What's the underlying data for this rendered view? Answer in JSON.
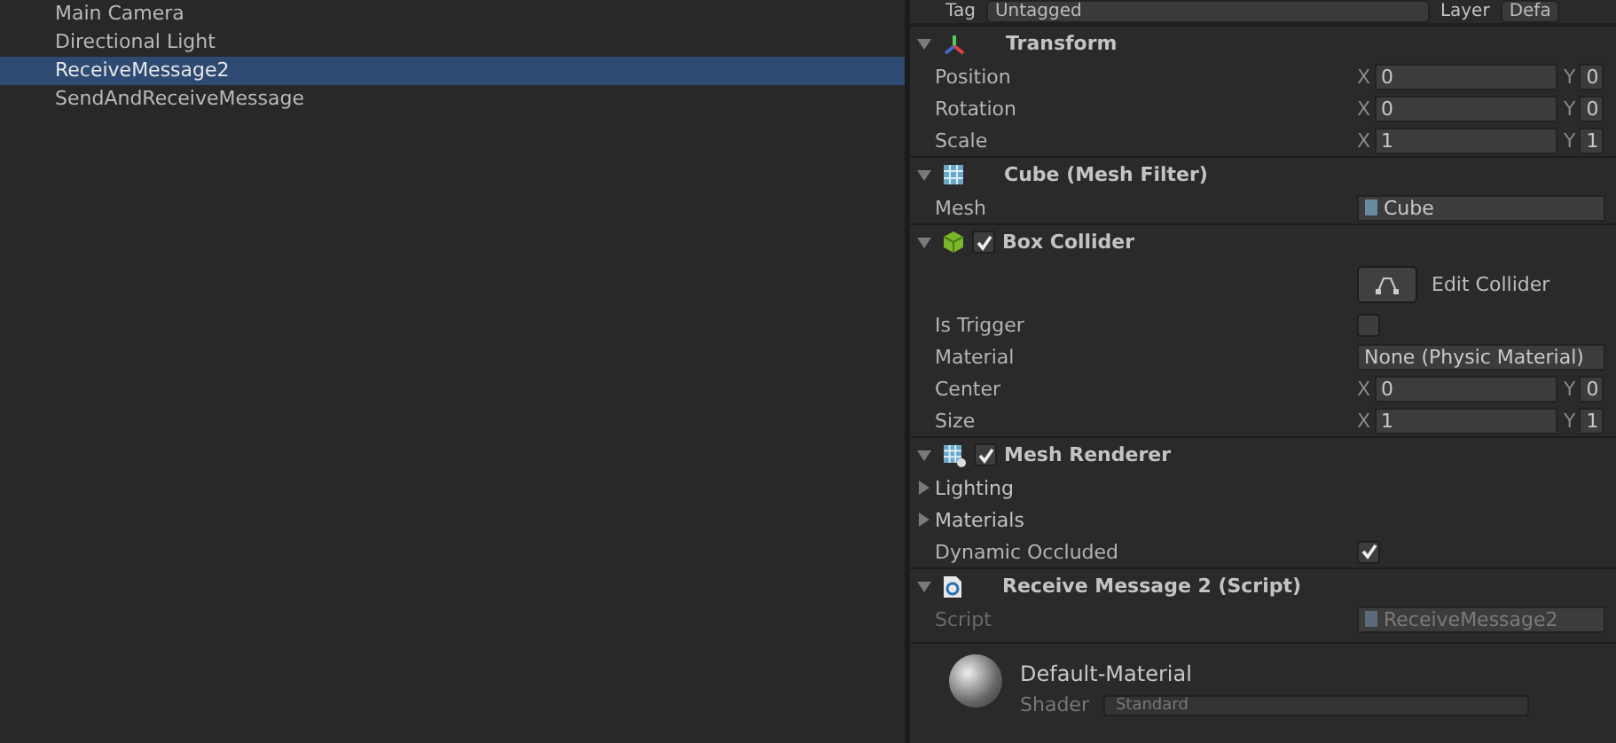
{
  "hierarchy": {
    "items": [
      {
        "label": "Main Camera",
        "selected": false
      },
      {
        "label": "Directional Light",
        "selected": false
      },
      {
        "label": "ReceiveMessage2",
        "selected": true
      },
      {
        "label": "SendAndReceiveMessage",
        "selected": false
      }
    ]
  },
  "inspector": {
    "header": {
      "tag_label": "Tag",
      "tag_value": "Untagged",
      "layer_label": "Layer",
      "layer_value": "Defa"
    },
    "components": [
      {
        "title": "Transform",
        "kind": "transform",
        "expanded": true,
        "rows": [
          {
            "kind": "vector",
            "label": "Position",
            "axes": [
              {
                "axis": "X",
                "value": "0"
              },
              {
                "axis": "Y",
                "value": "0"
              }
            ]
          },
          {
            "kind": "vector",
            "label": "Rotation",
            "axes": [
              {
                "axis": "X",
                "value": "0"
              },
              {
                "axis": "Y",
                "value": "0"
              }
            ]
          },
          {
            "kind": "vector",
            "label": "Scale",
            "axes": [
              {
                "axis": "X",
                "value": "1"
              },
              {
                "axis": "Y",
                "value": "1"
              }
            ]
          }
        ]
      },
      {
        "title": "Cube (Mesh Filter)",
        "kind": "mesh",
        "expanded": true,
        "rows": [
          {
            "kind": "object",
            "label": "Mesh",
            "value": "Cube",
            "disabled": false
          }
        ]
      },
      {
        "title": "Box Collider",
        "kind": "collider",
        "enabled": true,
        "expanded": true,
        "rows": [
          {
            "kind": "button",
            "value": "Edit Collider"
          },
          {
            "kind": "checkbox",
            "label": "Is Trigger",
            "checked": false
          },
          {
            "kind": "dropdown",
            "label": "Material",
            "value": "None (Physic Material)"
          },
          {
            "kind": "vector",
            "label": "Center",
            "axes": [
              {
                "axis": "X",
                "value": "0"
              },
              {
                "axis": "Y",
                "value": "0"
              }
            ]
          },
          {
            "kind": "vector",
            "label": "Size",
            "axes": [
              {
                "axis": "X",
                "value": "1"
              },
              {
                "axis": "Y",
                "value": "1"
              }
            ]
          }
        ]
      },
      {
        "title": "Mesh Renderer",
        "kind": "renderer",
        "enabled": true,
        "expanded": true,
        "rows": [
          {
            "kind": "foldout",
            "label": "Lighting",
            "expanded": false
          },
          {
            "kind": "foldout",
            "label": "Materials",
            "expanded": false
          },
          {
            "kind": "checkbox",
            "label": "Dynamic Occluded",
            "checked": true
          }
        ]
      },
      {
        "title": "Receive Message 2 (Script)",
        "kind": "script",
        "expanded": true,
        "rows": [
          {
            "kind": "object",
            "label": "Script",
            "value": "ReceiveMessage2",
            "disabled": true
          }
        ]
      }
    ],
    "material": {
      "name": "Default-Material",
      "shader_label": "Shader",
      "shader_value": "Standard"
    }
  }
}
